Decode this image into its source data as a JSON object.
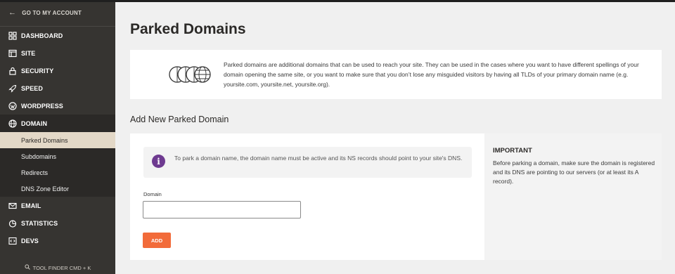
{
  "sidebar": {
    "back_label": "GO TO MY ACCOUNT",
    "items": [
      {
        "label": "DASHBOARD",
        "icon": "dashboard-icon"
      },
      {
        "label": "SITE",
        "icon": "site-icon"
      },
      {
        "label": "SECURITY",
        "icon": "lock-icon"
      },
      {
        "label": "SPEED",
        "icon": "rocket-icon"
      },
      {
        "label": "WORDPRESS",
        "icon": "wordpress-icon"
      },
      {
        "label": "DOMAIN",
        "icon": "globe-icon"
      },
      {
        "label": "EMAIL",
        "icon": "envelope-icon"
      },
      {
        "label": "STATISTICS",
        "icon": "pie-chart-icon"
      },
      {
        "label": "DEVS",
        "icon": "code-icon"
      }
    ],
    "domain_subitems": [
      {
        "label": "Parked Domains",
        "active": true
      },
      {
        "label": "Subdomains",
        "active": false
      },
      {
        "label": "Redirects",
        "active": false
      },
      {
        "label": "DNS Zone Editor",
        "active": false
      }
    ],
    "tool_finder": "TOOL FINDER CMD + K"
  },
  "main": {
    "title": "Parked Domains",
    "info_text": "Parked domains are additional domains that can be used to reach your site. They can be used in the cases where you want to have different spellings of your domain opening the same site, or you want to make sure that you don’t lose any misguided visitors by having all TLDs of your primary domain name (e.g. yoursite.com, yoursite.net, yoursite.org).",
    "section_title": "Add New Parked Domain",
    "notice_text": "To park a domain name, the domain name must be active and its NS records should point to your site's DNS.",
    "domain_label": "Domain",
    "domain_value": "",
    "add_button": "ADD",
    "important_title": "IMPORTANT",
    "important_text": "Before parking a domain, make sure the domain is registered and its DNS are pointing to our servers (or at least its A record)."
  },
  "colors": {
    "sidebar_bg": "#363431",
    "active_sub_bg": "#e3d8c7",
    "accent_button": "#f26b3a",
    "notice_icon": "#6e3a90"
  }
}
